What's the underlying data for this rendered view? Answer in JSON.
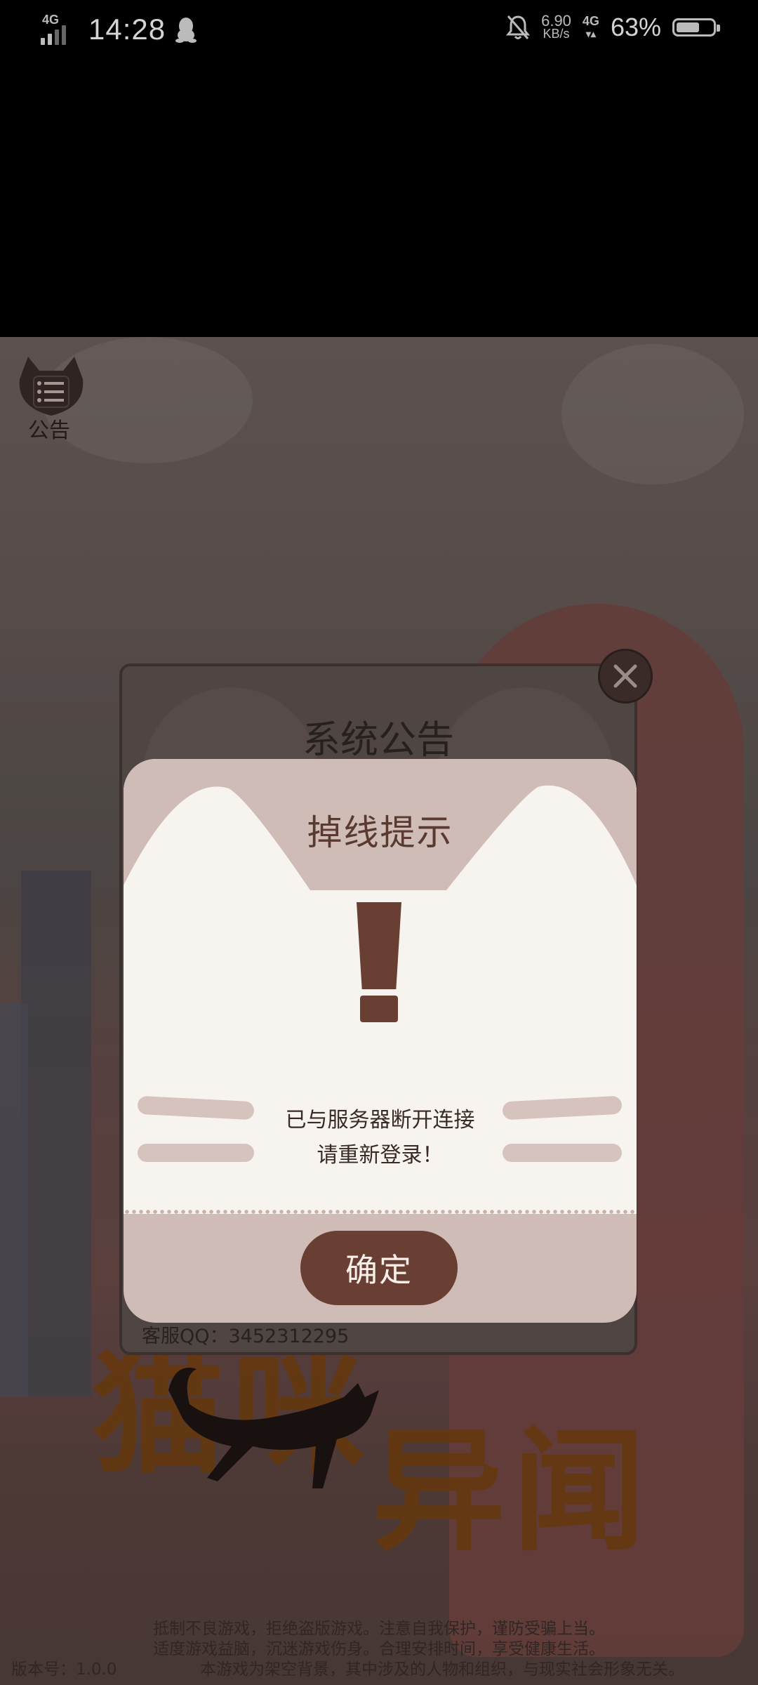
{
  "status_bar": {
    "network_tag": "4G",
    "time": "14:28",
    "speed_value": "6.90",
    "speed_unit": "KB/s",
    "network_type": "4G",
    "battery_percent": "63%",
    "battery_level": 0.63
  },
  "game": {
    "notice_button_label": "公告",
    "logo_text_1": "猫咪",
    "logo_text_2": "异闻",
    "footer_line_1": "抵制不良游戏，拒绝盗版游戏。注意自我保护，谨防受骗上当。",
    "footer_line_2": "适度游戏益脑，沉迷游戏伤身。合理安排时间，享受健康生活。",
    "version": "版本号：1.0.0",
    "footer_line_3": "本游戏为架空背景，其中涉及的人物和组织，与现实社会形象无关。"
  },
  "notice_panel": {
    "title": "系统公告",
    "customer_service": "客服QQ：3452312295"
  },
  "dialog": {
    "title": "掉线提示",
    "message_line_1": "已与服务器断开连接",
    "message_line_2": "请重新登录！",
    "confirm_label": "确定"
  },
  "colors": {
    "dialog_accent": "#6a3f33",
    "dialog_bg": "#f7f3ef",
    "dialog_frame": "#d0bcb6"
  }
}
